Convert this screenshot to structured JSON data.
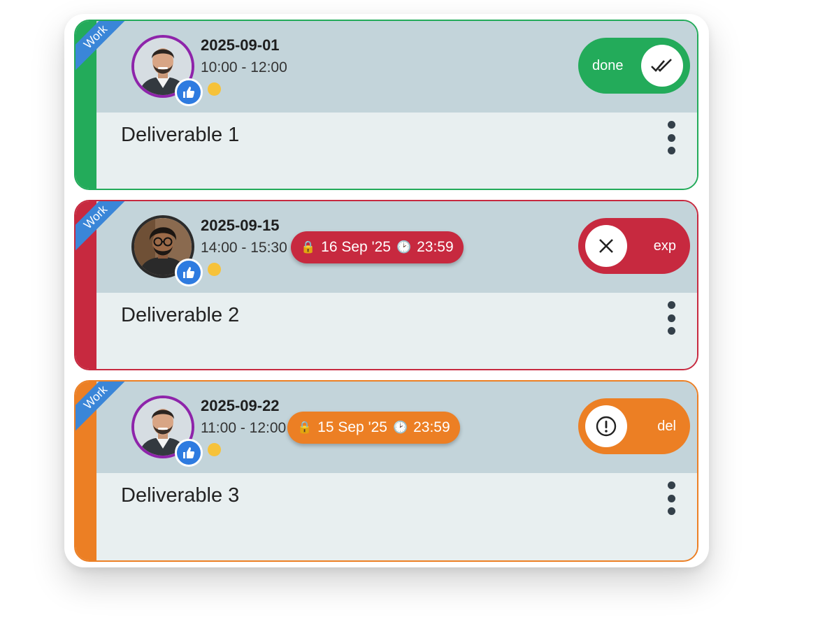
{
  "colors": {
    "green": "#23ab5a",
    "red": "#c7293f",
    "orange": "#ec7f24",
    "header": "#c3d4da",
    "body": "#e8eff0",
    "ribbon": "#3a86d8",
    "like": "#2e7be0",
    "presence": "#f6c23a"
  },
  "cards": [
    {
      "tag": "Work",
      "date": "2025-09-01",
      "time": "10:00 - 12:00",
      "title": "Deliverable 1",
      "status": {
        "label": "done",
        "icon": "double-check-icon"
      }
    },
    {
      "tag": "Work",
      "date": "2025-09-15",
      "time": "14:00 - 15:30",
      "deadline": {
        "date": "16 Sep '25",
        "time": "23:59"
      },
      "title": "Deliverable 2",
      "status": {
        "label": "exp",
        "icon": "close-icon"
      }
    },
    {
      "tag": "Work",
      "date": "2025-09-22",
      "time": "11:00 - 12:00",
      "deadline": {
        "date": "15 Sep '25",
        "time": "23:59"
      },
      "title": "Deliverable 3",
      "status": {
        "label": "del",
        "icon": "alert-icon"
      }
    }
  ]
}
